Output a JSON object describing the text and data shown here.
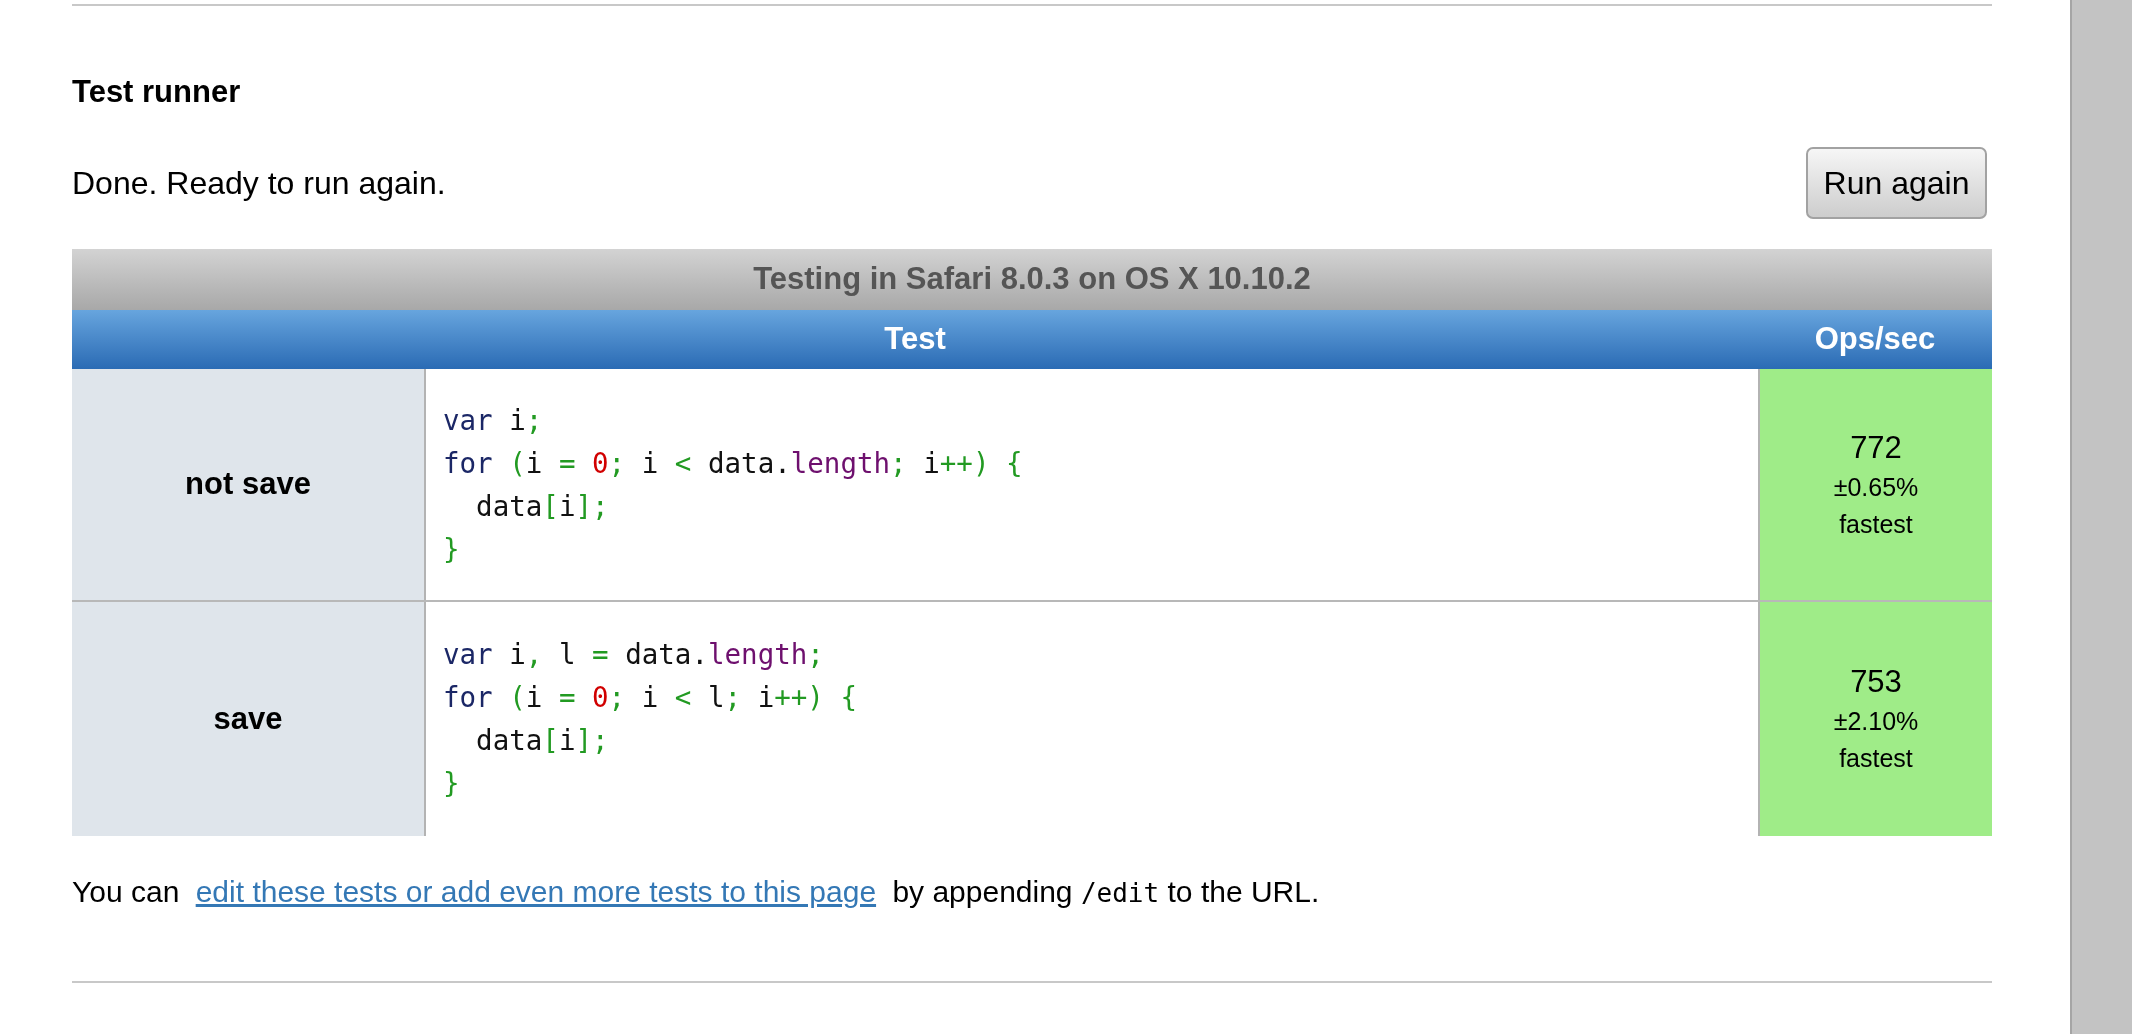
{
  "section": {
    "title": "Test runner",
    "status": "Done. Ready to run again.",
    "run_button": {
      "label": "Run again"
    }
  },
  "results_table": {
    "caption": "Testing in Safari 8.0.3 on OS X 10.10.2",
    "columns": [
      "Test",
      "Ops/sec"
    ],
    "rows": [
      {
        "name": "not save",
        "code": [
          [
            {
              "kind": "keyword",
              "text": "var"
            },
            {
              "kind": "plain",
              "text": " i"
            },
            {
              "kind": "punctuation",
              "text": ";"
            }
          ],
          [
            {
              "kind": "keyword",
              "text": "for "
            },
            {
              "kind": "punctuation",
              "text": "("
            },
            {
              "kind": "plain",
              "text": "i "
            },
            {
              "kind": "punctuation",
              "text": "= "
            },
            {
              "kind": "literal",
              "text": "0"
            },
            {
              "kind": "punctuation",
              "text": ";"
            },
            {
              "kind": "plain",
              "text": " i "
            },
            {
              "kind": "punctuation",
              "text": "<"
            },
            {
              "kind": "plain",
              "text": " data."
            },
            {
              "kind": "property",
              "text": "length"
            },
            {
              "kind": "punctuation",
              "text": ";"
            },
            {
              "kind": "plain",
              "text": " i"
            },
            {
              "kind": "punctuation",
              "text": "++) {"
            }
          ],
          [
            {
              "kind": "plain",
              "text": "  data"
            },
            {
              "kind": "punctuation",
              "text": "["
            },
            {
              "kind": "plain",
              "text": "i"
            },
            {
              "kind": "punctuation",
              "text": "];"
            }
          ],
          [
            {
              "kind": "punctuation",
              "text": "}"
            }
          ]
        ],
        "ops_per_sec": "772",
        "error": "±0.65%",
        "rank": "fastest"
      },
      {
        "name": "save",
        "code": [
          [
            {
              "kind": "keyword",
              "text": "var"
            },
            {
              "kind": "plain",
              "text": " i"
            },
            {
              "kind": "punctuation",
              "text": ", "
            },
            {
              "kind": "plain",
              "text": "l "
            },
            {
              "kind": "punctuation",
              "text": "= "
            },
            {
              "kind": "plain",
              "text": "data."
            },
            {
              "kind": "property",
              "text": "length"
            },
            {
              "kind": "punctuation",
              "text": ";"
            }
          ],
          [
            {
              "kind": "keyword",
              "text": "for "
            },
            {
              "kind": "punctuation",
              "text": "("
            },
            {
              "kind": "plain",
              "text": "i "
            },
            {
              "kind": "punctuation",
              "text": "= "
            },
            {
              "kind": "literal",
              "text": "0"
            },
            {
              "kind": "punctuation",
              "text": ";"
            },
            {
              "kind": "plain",
              "text": " i "
            },
            {
              "kind": "punctuation",
              "text": "<"
            },
            {
              "kind": "plain",
              "text": " l"
            },
            {
              "kind": "punctuation",
              "text": ";"
            },
            {
              "kind": "plain",
              "text": " i"
            },
            {
              "kind": "punctuation",
              "text": "++) {"
            }
          ],
          [
            {
              "kind": "plain",
              "text": "  data"
            },
            {
              "kind": "punctuation",
              "text": "["
            },
            {
              "kind": "plain",
              "text": "i"
            },
            {
              "kind": "punctuation",
              "text": "];"
            }
          ],
          [
            {
              "kind": "punctuation",
              "text": "}"
            }
          ]
        ],
        "ops_per_sec": "753",
        "error": "±2.10%",
        "rank": "fastest"
      }
    ]
  },
  "footer_note": {
    "parts": [
      {
        "kind": "text",
        "text": "You can "
      },
      {
        "kind": "link",
        "text": "edit these tests or add even more tests to this page"
      },
      {
        "kind": "text",
        "text": " by appending "
      },
      {
        "kind": "code",
        "text": "/edit"
      },
      {
        "kind": "text",
        "text": " to the URL."
      }
    ]
  }
}
